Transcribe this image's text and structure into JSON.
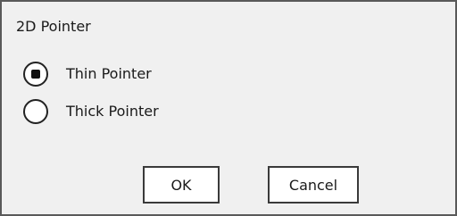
{
  "dialog": {
    "title": "2D Pointer",
    "options": [
      {
        "label": "Thin Pointer",
        "selected": true
      },
      {
        "label": "Thick Pointer",
        "selected": false
      }
    ],
    "buttons": {
      "ok_label": "OK",
      "cancel_label": "Cancel"
    }
  }
}
